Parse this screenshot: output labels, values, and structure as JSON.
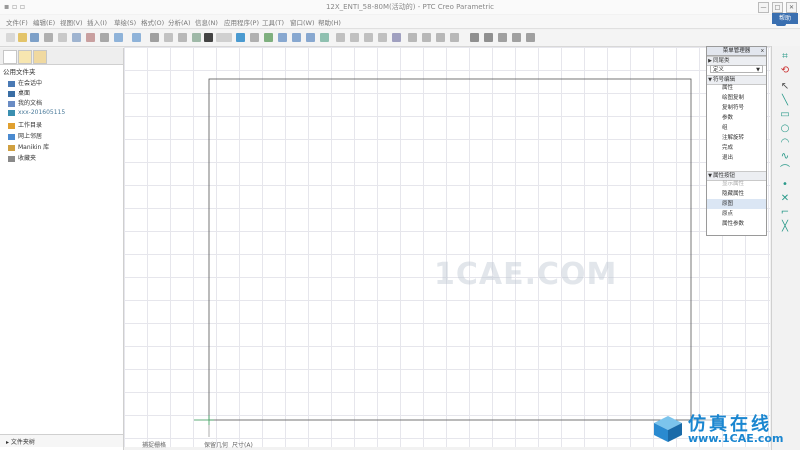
{
  "window": {
    "title": "12X_ENTI_58-80M(活动的) - PTC Creo Parametric",
    "minimize_label": "—",
    "maximize_label": "□",
    "close_label": "✕"
  },
  "menu": {
    "items": [
      "文件(F)",
      "编辑(E)",
      "视图(V)",
      "插入(I)",
      "草绘(S)",
      "格式(O)",
      "分析(A)",
      "信息(N)",
      "应用程序(P)",
      "工具(T)",
      "窗口(W)",
      "帮助(H)"
    ],
    "help_tag": "帮助"
  },
  "navigator": {
    "header": "公用文件夹",
    "items": [
      {
        "label": "在会话中",
        "icon": "session-icon",
        "color": "#4a7ab5"
      },
      {
        "label": "桌面",
        "icon": "desktop-icon",
        "color": "#3a6ea5"
      },
      {
        "label": "我的文档",
        "icon": "documents-icon",
        "color": "#6a8cc4"
      },
      {
        "label": "xxx-201605115",
        "icon": "computer-icon",
        "color": "#3a8fb0"
      },
      {
        "label": "工作目录",
        "icon": "working-dir-icon",
        "color": "#e0a030"
      },
      {
        "label": "网上邻居",
        "icon": "network-icon",
        "color": "#4a8ad0"
      },
      {
        "label": "Manikin 库",
        "icon": "manikin-library-icon",
        "color": "#d0a040"
      },
      {
        "label": "收藏夹",
        "icon": "favorites-icon",
        "color": "#8a8a8a"
      }
    ],
    "footer": "文件夹树"
  },
  "menu_manager": {
    "title": "菜单管理器",
    "close": "x",
    "sections": [
      {
        "label": "同尾类",
        "expanded": false
      },
      {
        "label": "符号编辑",
        "expanded": true
      },
      {
        "label": "属性按钮",
        "expanded": true
      }
    ],
    "dropdown_value": "定义",
    "symbol_edit_items": [
      "属性",
      "绘图复制",
      "复制符号",
      "参数",
      "组",
      "注解旋转",
      "完成",
      "退出"
    ],
    "attr_items": [
      {
        "label": "显示属性",
        "disabled": true
      },
      {
        "label": "隐藏属性",
        "disabled": false
      },
      {
        "label": "原图",
        "disabled": false,
        "selected": true
      },
      {
        "label": "原点",
        "disabled": false
      },
      {
        "label": "属性参数",
        "disabled": false
      }
    ]
  },
  "status": {
    "items": [
      "捕捉栅格",
      "保留几何",
      "尺寸(A)"
    ]
  },
  "watermark": "1CAE.COM",
  "logo": {
    "cn": "仿真在线",
    "url": "www.1CAE.com"
  },
  "colors": {
    "accent": "#3a6fb0",
    "sketch_green": "#2b9a8a",
    "logo_blue": "#1a86d0"
  }
}
